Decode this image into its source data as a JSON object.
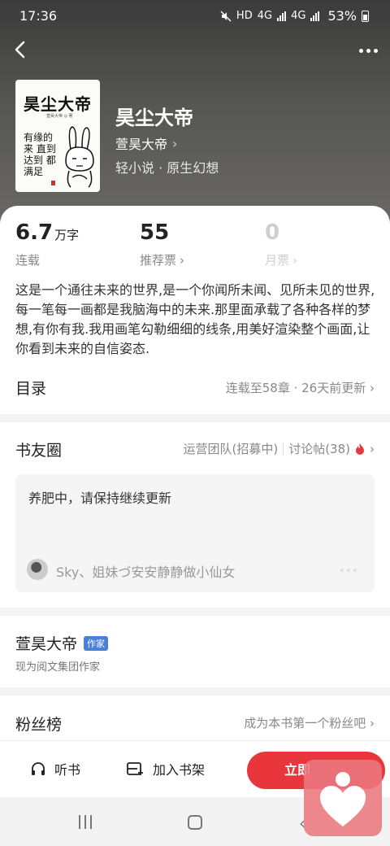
{
  "status_bar": {
    "time": "17:36",
    "indicators": [
      "mute-icon",
      "HD",
      "4G",
      "4G",
      "battery-icon"
    ],
    "hd": "HD",
    "net1": "4G",
    "net2": "4G",
    "battery": "53%"
  },
  "book": {
    "title": "昊尘大帝",
    "author": "萱昊大帝",
    "meta": "轻小说 · 原生幻想",
    "cover_title": "昊尘大帝",
    "cover_subtitle": "萱昊大帝 ◎ 著",
    "cover_lines": "有缘的来 直到 达到 都满足"
  },
  "stats": {
    "words_value": "6.7",
    "words_unit": "万字",
    "words_label": "连载",
    "rec_value": "55",
    "rec_label": "推荐票",
    "month_value": "0",
    "month_label": "月票"
  },
  "description": "这是一个通往未来的世界,是一个你闻所未闻、见所未见的世界,每一笔每一画都是我脑海中的未来.那里面承载了各种各样的梦想,有你有我.我用画笔勾勒细细的线条,用美好渲染整个画面,让你看到未来的自信姿态.",
  "toc": {
    "title": "目录",
    "status": "连载至58章 · 26天前更新"
  },
  "circle": {
    "title": "书友圈",
    "team": "运营团队(招募中)",
    "threads": "讨论帖(38)",
    "post_text": "养肥中，请保持继续更新",
    "post_users": "Sky、姐妹づ安安静静做小仙女"
  },
  "author_section": {
    "name": "萱昊大帝",
    "badge": "作家",
    "subtitle": "现为阅文集团作家"
  },
  "fans": {
    "title": "粉丝榜",
    "cta": "成为本书第一个粉丝吧"
  },
  "bottom_bar": {
    "listen": "听书",
    "shelf": "加入书架",
    "read": "立即"
  },
  "colors": {
    "accent": "#e8363c",
    "badge": "#4a7fd6",
    "hero_top": "#3b3b3b",
    "hero_bottom": "#6a6966"
  }
}
